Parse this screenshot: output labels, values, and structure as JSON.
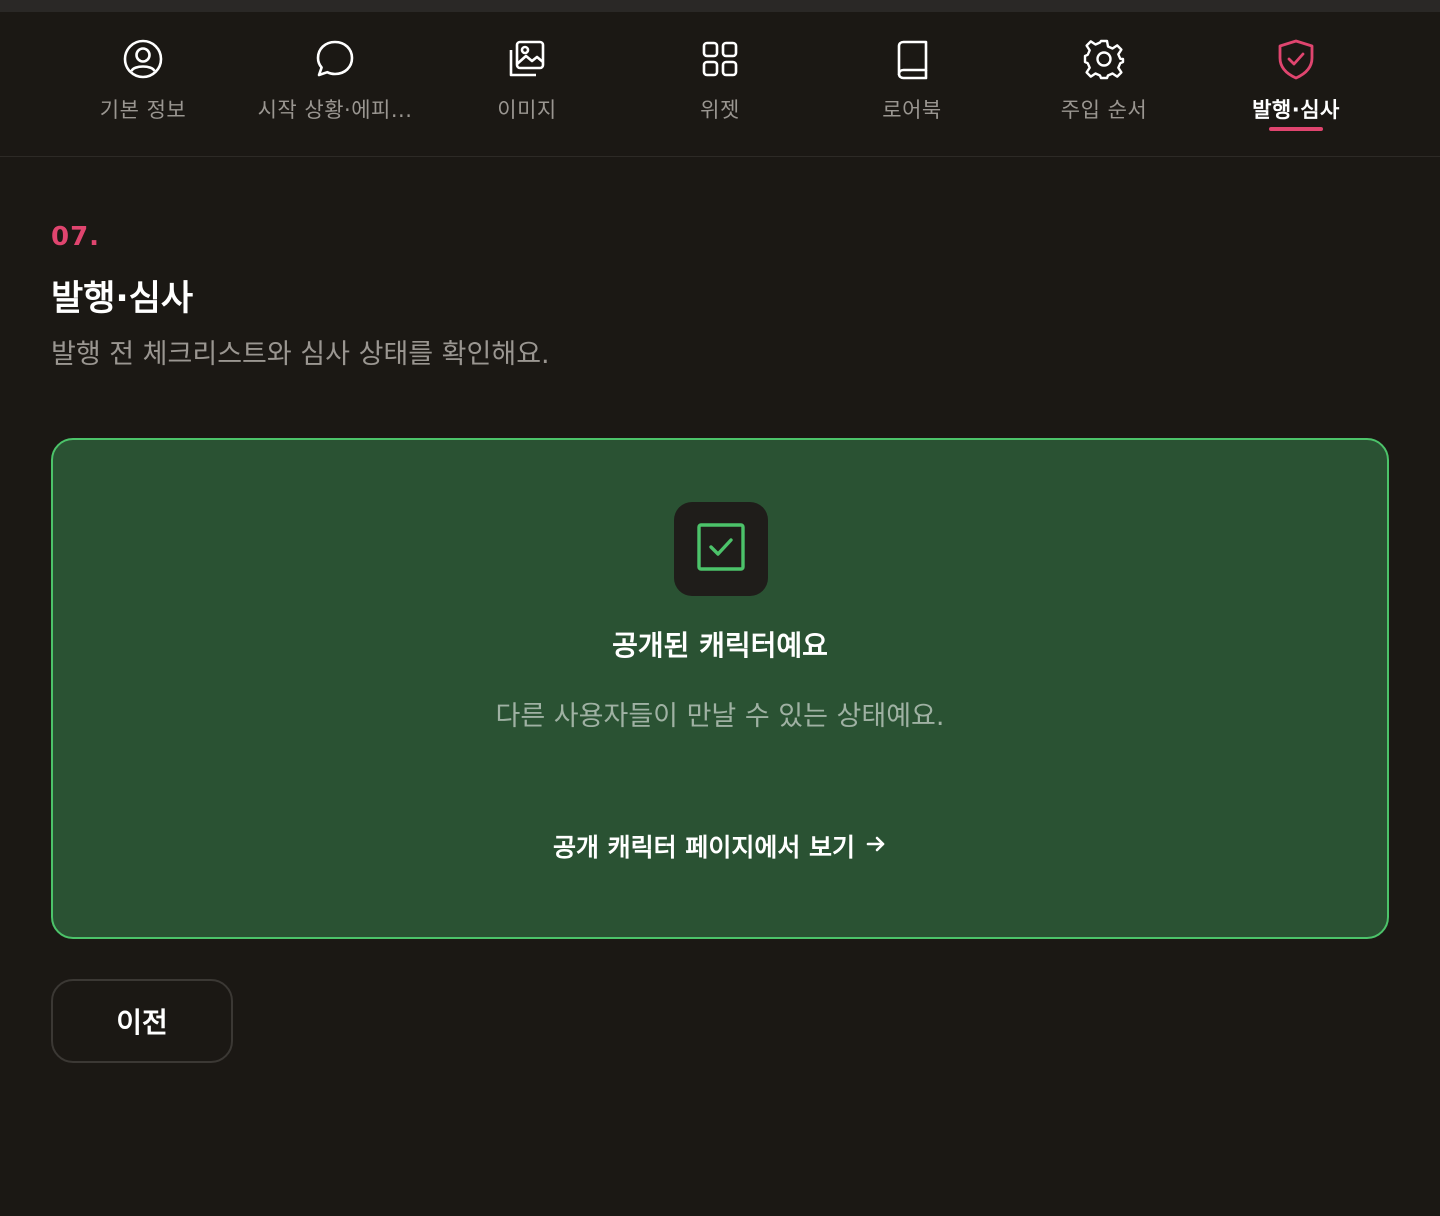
{
  "colors": {
    "background": "#1b1814",
    "accent": "#e0456f",
    "success_bg": "#2a5233",
    "success_border": "#4cc36a",
    "muted_text": "#9a9691"
  },
  "tabs": [
    {
      "label": "기본 정보",
      "icon": "user-circle-icon",
      "active": false
    },
    {
      "label": "시작 상황·에피...",
      "icon": "chat-bubble-icon",
      "active": false
    },
    {
      "label": "이미지",
      "icon": "images-icon",
      "active": false
    },
    {
      "label": "위젯",
      "icon": "grid-icon",
      "active": false
    },
    {
      "label": "로어북",
      "icon": "book-icon",
      "active": false
    },
    {
      "label": "주입 순서",
      "icon": "gear-icon",
      "active": false
    },
    {
      "label": "발행·심사",
      "icon": "shield-check-icon",
      "active": true
    }
  ],
  "section": {
    "step": "07.",
    "title": "발행·심사",
    "subtitle": "발행 전 체크리스트와 심사 상태를 확인해요."
  },
  "status": {
    "icon": "checkbox-check-icon",
    "title": "공개된 캐릭터예요",
    "description": "다른 사용자들이 만날 수 있는 상태예요.",
    "link_label": "공개 캐릭터 페이지에서 보기"
  },
  "footer": {
    "prev_label": "이전"
  }
}
